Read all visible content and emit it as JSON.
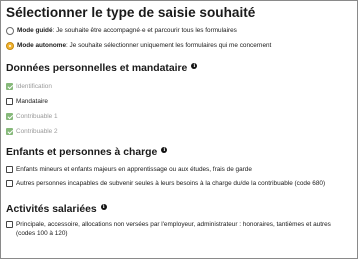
{
  "page": {
    "title": "Sélectionner le type de saisie souhaité"
  },
  "mode": {
    "options": [
      {
        "strong": "Mode guidé",
        "text": " : Je souhaite être accompagné·e et parcourir tous les formulaires",
        "selected": false
      },
      {
        "strong": "Mode autonome",
        "text": " : Je souhaite sélectionner uniquement les formulaires qui me concernent",
        "selected": true
      }
    ]
  },
  "sections": [
    {
      "heading": "Données personnelles et mandataire",
      "items": [
        {
          "label": "Identification",
          "checked": true,
          "disabled": true
        },
        {
          "label": "Mandataire",
          "checked": false,
          "disabled": false
        },
        {
          "label": "Contribuable 1",
          "checked": true,
          "disabled": true
        },
        {
          "label": "Contribuable 2",
          "checked": true,
          "disabled": true
        }
      ]
    },
    {
      "heading": "Enfants et personnes à charge",
      "items": [
        {
          "label": "Enfants mineurs et enfants majeurs en apprentissage ou aux études, frais de garde",
          "checked": false,
          "disabled": false
        },
        {
          "label": "Autres personnes incapables de subvenir seules à leurs besoins à la charge du/de la contribuable (code 680)",
          "checked": false,
          "disabled": false
        }
      ]
    },
    {
      "heading": "Activités salariées",
      "items": [
        {
          "label": "Principale, accessoire, allocations non versées par l'employeur, administrateur : honoraires, tantièmes et autres (codes 100 à 120)",
          "checked": false,
          "disabled": false
        }
      ]
    }
  ],
  "icons": {
    "info": "info-icon",
    "check": "checkmark-icon"
  },
  "colors": {
    "accent": "#f2b533",
    "checked": "#86b97a",
    "muted": "#9a9a9a"
  }
}
